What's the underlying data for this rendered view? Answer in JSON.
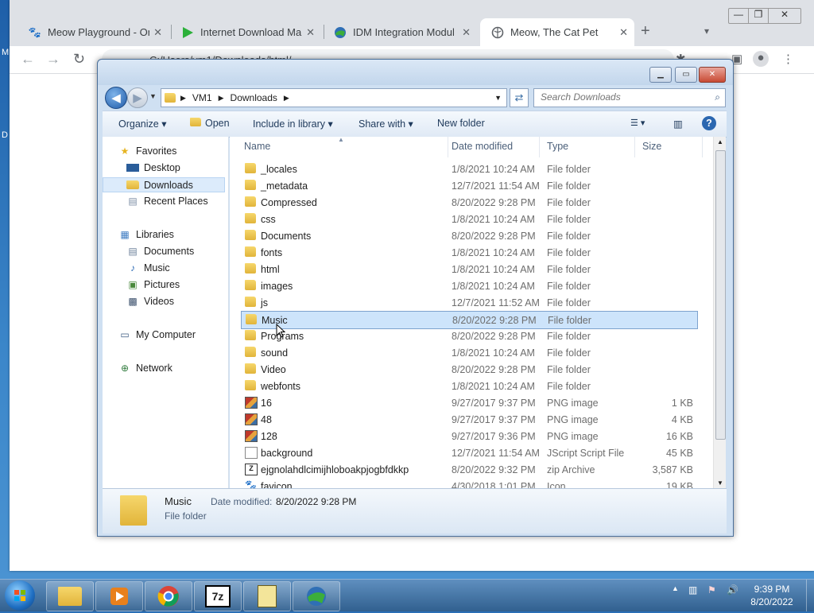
{
  "desktop": {
    "icon1": "M",
    "icon2": "D"
  },
  "chrome": {
    "tabs": [
      {
        "title": "Meow Playground - Onli",
        "icon": "paw-icon"
      },
      {
        "title": "Internet Download Man",
        "icon": "idm-play-icon"
      },
      {
        "title": "IDM Integration Module",
        "icon": "idm-globe-icon"
      },
      {
        "title": "Meow, The Cat Pet",
        "icon": "globe-icon"
      }
    ],
    "new_tab": "+",
    "tab_close": "✕",
    "address_partial": "C:/Users/vm1/Downloads/html/...",
    "window_controls": {
      "minimize": "—",
      "maximize": "❐",
      "close": "✕"
    }
  },
  "explorer": {
    "breadcrumb": [
      "VM1",
      "Downloads"
    ],
    "search_placeholder": "Search Downloads",
    "commands": {
      "organize": "Organize",
      "open": "Open",
      "include": "Include in library",
      "share": "Share with",
      "new_folder": "New folder"
    },
    "nav": {
      "favorites": "Favorites",
      "desktop": "Desktop",
      "downloads": "Downloads",
      "recent": "Recent Places",
      "libraries": "Libraries",
      "documents": "Documents",
      "music": "Music",
      "pictures": "Pictures",
      "videos": "Videos",
      "computer": "My Computer",
      "network": "Network"
    },
    "columns": {
      "name": "Name",
      "date": "Date modified",
      "type": "Type",
      "size": "Size"
    },
    "files": [
      {
        "name": "_locales",
        "date": "1/8/2021 10:24 AM",
        "type": "File folder",
        "size": "",
        "kind": "folder"
      },
      {
        "name": "_metadata",
        "date": "12/7/2021 11:54 AM",
        "type": "File folder",
        "size": "",
        "kind": "folder"
      },
      {
        "name": "Compressed",
        "date": "8/20/2022 9:28 PM",
        "type": "File folder",
        "size": "",
        "kind": "folder"
      },
      {
        "name": "css",
        "date": "1/8/2021 10:24 AM",
        "type": "File folder",
        "size": "",
        "kind": "folder"
      },
      {
        "name": "Documents",
        "date": "8/20/2022 9:28 PM",
        "type": "File folder",
        "size": "",
        "kind": "folder"
      },
      {
        "name": "fonts",
        "date": "1/8/2021 10:24 AM",
        "type": "File folder",
        "size": "",
        "kind": "folder"
      },
      {
        "name": "html",
        "date": "1/8/2021 10:24 AM",
        "type": "File folder",
        "size": "",
        "kind": "folder"
      },
      {
        "name": "images",
        "date": "1/8/2021 10:24 AM",
        "type": "File folder",
        "size": "",
        "kind": "folder"
      },
      {
        "name": "js",
        "date": "12/7/2021 11:52 AM",
        "type": "File folder",
        "size": "",
        "kind": "folder"
      },
      {
        "name": "Music",
        "date": "8/20/2022 9:28 PM",
        "type": "File folder",
        "size": "",
        "kind": "folder"
      },
      {
        "name": "Programs",
        "date": "8/20/2022 9:28 PM",
        "type": "File folder",
        "size": "",
        "kind": "folder"
      },
      {
        "name": "sound",
        "date": "1/8/2021 10:24 AM",
        "type": "File folder",
        "size": "",
        "kind": "folder"
      },
      {
        "name": "Video",
        "date": "8/20/2022 9:28 PM",
        "type": "File folder",
        "size": "",
        "kind": "folder"
      },
      {
        "name": "webfonts",
        "date": "1/8/2021 10:24 AM",
        "type": "File folder",
        "size": "",
        "kind": "folder"
      },
      {
        "name": "16",
        "date": "9/27/2017 9:37 PM",
        "type": "PNG image",
        "size": "1 KB",
        "kind": "png"
      },
      {
        "name": "48",
        "date": "9/27/2017 9:37 PM",
        "type": "PNG image",
        "size": "4 KB",
        "kind": "png"
      },
      {
        "name": "128",
        "date": "9/27/2017 9:36 PM",
        "type": "PNG image",
        "size": "16 KB",
        "kind": "png"
      },
      {
        "name": "background",
        "date": "12/7/2021 11:54 AM",
        "type": "JScript Script File",
        "size": "45 KB",
        "kind": "script"
      },
      {
        "name": "ejgnolahdlcimijhloboakpjogbfdkkp",
        "date": "8/20/2022 9:32 PM",
        "type": "zip Archive",
        "size": "3,587 KB",
        "kind": "zip"
      },
      {
        "name": "favicon",
        "date": "4/30/2018 1:01 PM",
        "type": "Icon",
        "size": "19 KB",
        "kind": "icon"
      }
    ],
    "selected_index": 9,
    "details": {
      "name": "Music",
      "date_label": "Date modified:",
      "date_value": "8/20/2022 9:28 PM",
      "type": "File folder"
    }
  },
  "taskbar": {
    "clock_time": "9:39 PM",
    "clock_date": "8/20/2022",
    "apps": [
      "explorer",
      "media-player",
      "chrome",
      "7zip",
      "archive",
      "idm"
    ]
  }
}
